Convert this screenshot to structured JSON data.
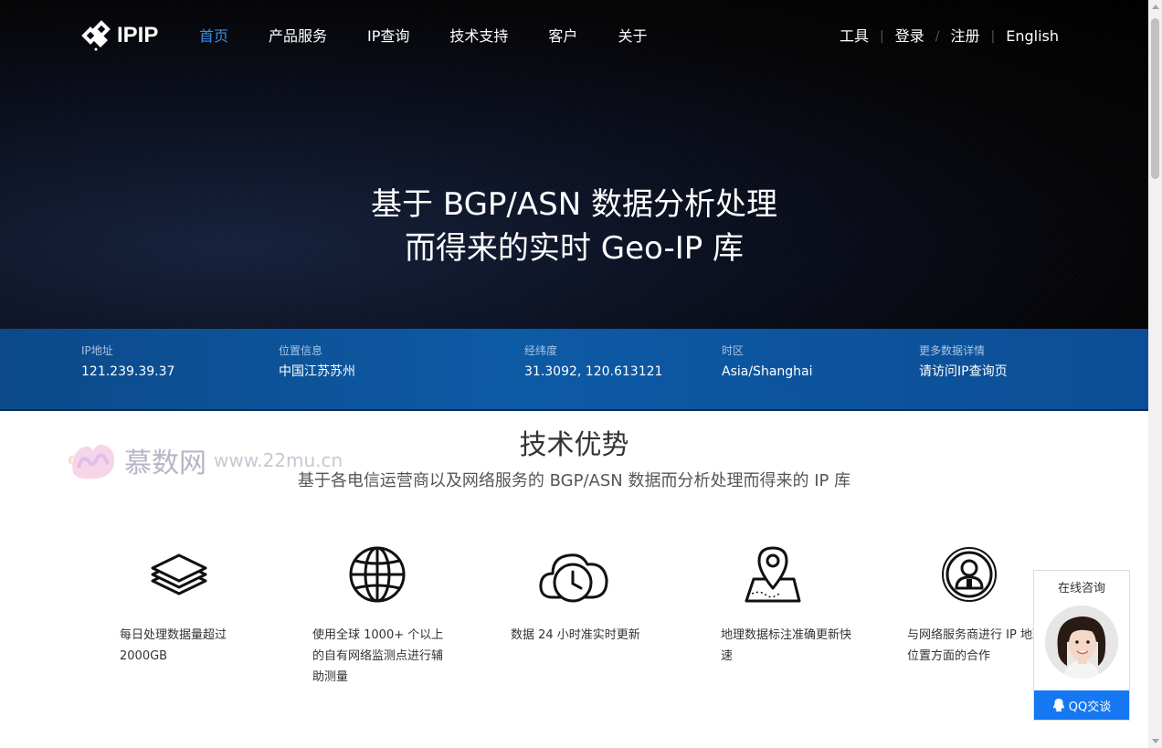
{
  "nav": {
    "logo_text": "IPIP",
    "menu": [
      {
        "label": "首页",
        "active": true
      },
      {
        "label": "产品服务"
      },
      {
        "label": "IP查询"
      },
      {
        "label": "技术支持"
      },
      {
        "label": "客户"
      },
      {
        "label": "关于"
      }
    ],
    "right_links": [
      "工具",
      "登录",
      "注册",
      "English"
    ]
  },
  "hero": {
    "title_line1": "基于 BGP/ASN 数据分析处理",
    "title_line2": "而得来的实时 Geo-IP 库"
  },
  "infobar": [
    {
      "label": "IP地址",
      "value": "121.239.39.37"
    },
    {
      "label": "位置信息",
      "value": "中国江苏苏州"
    },
    {
      "label": "经纬度",
      "value": "31.3092, 120.613121"
    },
    {
      "label": "时区",
      "value": "Asia/Shanghai"
    },
    {
      "label": "更多数据详情",
      "value": "请访问IP查询页"
    }
  ],
  "section": {
    "title": "技术优势",
    "subtitle": "基于各电信运营商以及网络服务的 BGP/ASN 数据而分析处理而得来的 IP 库"
  },
  "watermark": {
    "text": "慕数网",
    "url": "www.22mu.cn"
  },
  "features": [
    {
      "icon": "layers-icon",
      "text": "每日处理数据量超过 2000GB"
    },
    {
      "icon": "globe-icon",
      "text": "使用全球 1000+ 个以上的自有网络监测点进行辅助测量"
    },
    {
      "icon": "cloud-clock-icon",
      "text": "数据 24 小时准实时更新"
    },
    {
      "icon": "map-pin-icon",
      "text": "地理数据标注准确更新快速"
    },
    {
      "icon": "user-badge-icon",
      "text": "与网络服务商进行 IP 地理位置方面的合作"
    }
  ],
  "chat": {
    "title": "在线咨询",
    "button": "QQ交谈"
  },
  "colors": {
    "accent": "#3a8ee6",
    "infobar": "#0d5aa5",
    "chat_button": "#1677f2"
  }
}
